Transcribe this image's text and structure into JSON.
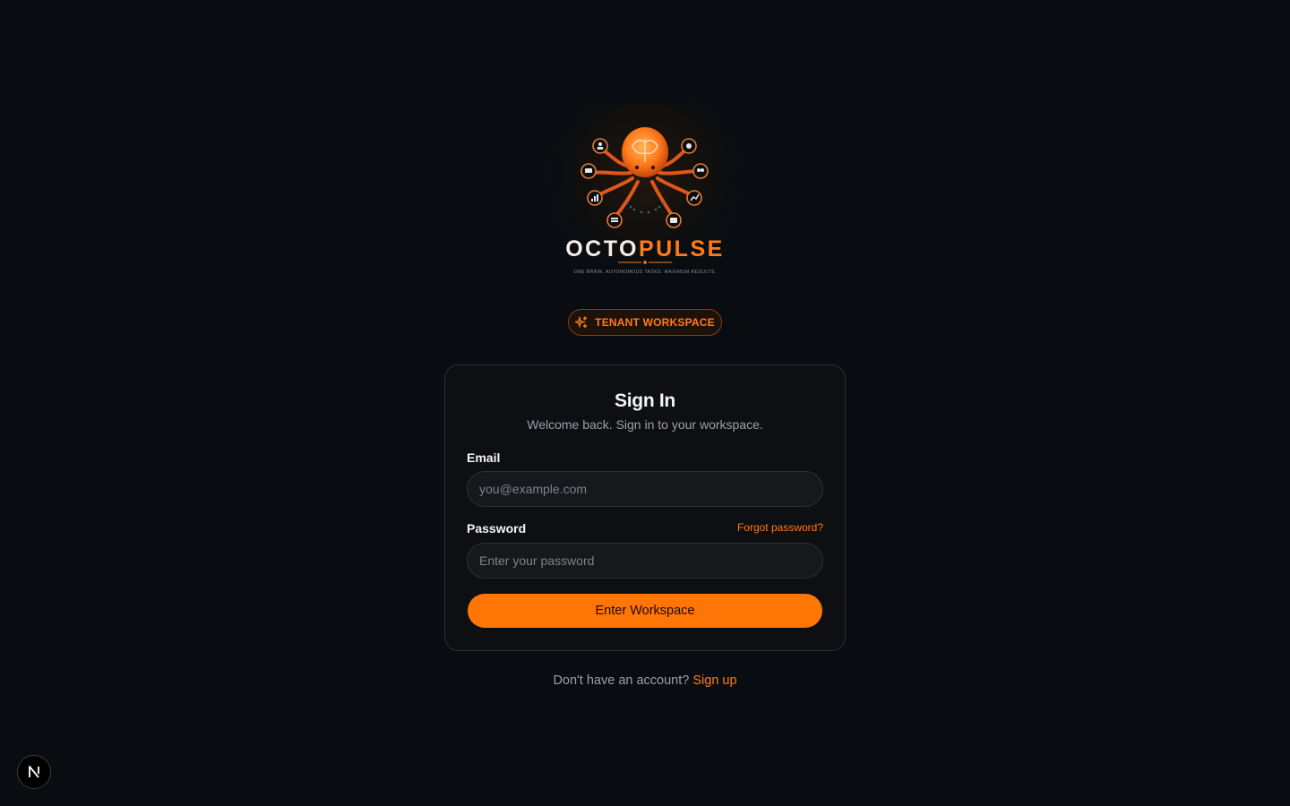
{
  "brand": {
    "name_part1": "OCTO",
    "name_part2": "PULSE",
    "tagline": "ONE BRAIN. AUTONOMOUS TASKS. MAXIMUM RESULTS."
  },
  "badge": {
    "label": "TENANT WORKSPACE",
    "icon": "sparkles-icon"
  },
  "card": {
    "title": "Sign In",
    "subtitle": "Welcome back. Sign in to your workspace.",
    "email": {
      "label": "Email",
      "placeholder": "you@example.com",
      "value": ""
    },
    "password": {
      "label": "Password",
      "placeholder": "Enter your password",
      "value": ""
    },
    "forgot_label": "Forgot password?",
    "submit_label": "Enter Workspace"
  },
  "signup": {
    "prompt": "Don't have an account?",
    "link_label": "Sign up"
  },
  "dev_indicator": {
    "letter": "N"
  },
  "colors": {
    "accent": "#ff7506",
    "background": "#090d11",
    "card": "#0e0f12"
  }
}
